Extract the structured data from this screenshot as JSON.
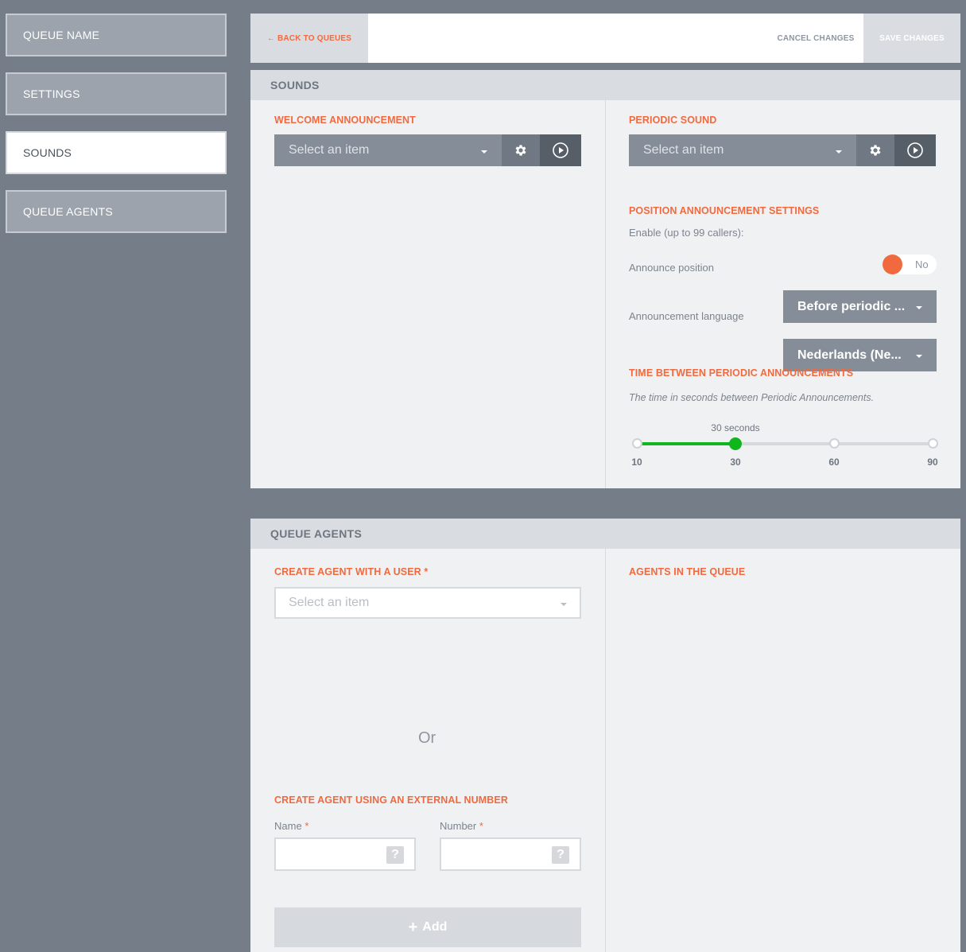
{
  "sidebar": {
    "items": [
      {
        "label": "QUEUE NAME"
      },
      {
        "label": "SETTINGS"
      },
      {
        "label": "SOUNDS"
      },
      {
        "label": "QUEUE AGENTS"
      }
    ]
  },
  "toolbar": {
    "back_label": "← BACK TO QUEUES",
    "cancel_label": "CANCEL CHANGES",
    "save_label": "SAVE CHANGES"
  },
  "sounds": {
    "title": "SOUNDS",
    "welcome": {
      "label": "WELCOME ANNOUNCEMENT",
      "placeholder": "Select an item",
      "settings_icon": "gear-icon",
      "play_icon": "play-circle-icon"
    },
    "periodic": {
      "label": "PERIODIC SOUND",
      "placeholder": "Select an item",
      "settings_icon": "gear-icon",
      "play_icon": "play-circle-icon"
    },
    "position": {
      "label": "POSITION ANNOUNCEMENT SETTINGS",
      "enable_label": "Enable (up to 99 callers):",
      "enable_value": "No",
      "announce_position_label": "Announce position",
      "announce_position_value": "Before periodic ...",
      "language_label": "Announcement language",
      "language_value": "Nederlands (Ne..."
    },
    "interval": {
      "label": "TIME BETWEEN PERIODIC ANNOUNCEMENTS",
      "help": "The time in seconds between Periodic Announcements.",
      "value_label": "30 seconds",
      "value": 30,
      "ticks": [
        "10",
        "30",
        "60",
        "90"
      ]
    }
  },
  "agents": {
    "title": "QUEUE AGENTS",
    "create_user_label": "CREATE AGENT WITH A USER",
    "required_mark": "*",
    "user_placeholder": "Select an item",
    "or_text": "Or",
    "external_label": "CREATE AGENT USING AN EXTERNAL NUMBER",
    "name_label": "Name",
    "number_label": "Number",
    "help_glyph": "?",
    "add_label": "Add",
    "agents_in_queue_label": "AGENTS IN THE QUEUE"
  },
  "colors": {
    "accent": "#f16a3f",
    "slider": "#11b51e",
    "background": "#747d88"
  }
}
